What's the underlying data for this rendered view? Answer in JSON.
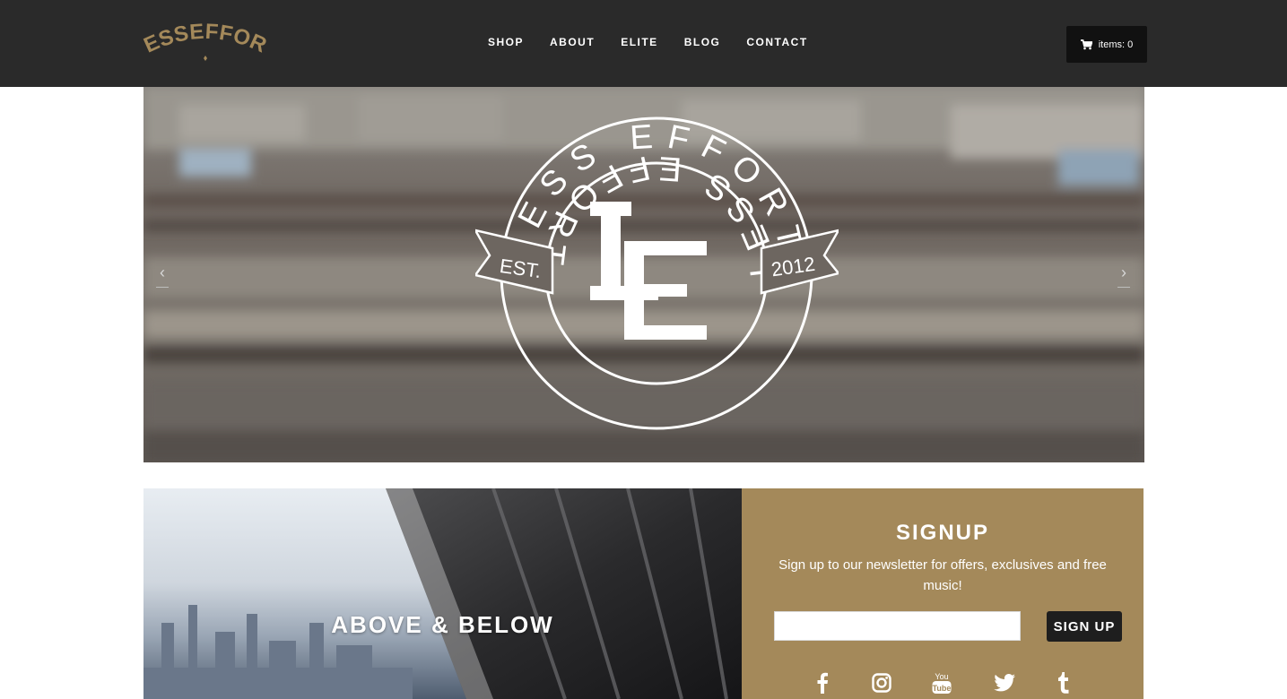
{
  "brand": {
    "logo_text": "LESSEFFORT"
  },
  "nav": {
    "items": [
      {
        "label": "SHOP"
      },
      {
        "label": "ABOUT"
      },
      {
        "label": "ELITE"
      },
      {
        "label": "BLOG"
      },
      {
        "label": "CONTACT"
      }
    ]
  },
  "cart": {
    "label": "items: 0",
    "icon": "cart-icon"
  },
  "hero": {
    "emblem": {
      "top_text": "LESS EFFORT",
      "bottom_text": "LESS EFFORT",
      "left_banner": "EST.",
      "right_banner": "2012",
      "monogram": "LE"
    },
    "prev_icon": "chevron-left-icon",
    "next_icon": "chevron-right-icon"
  },
  "promo": {
    "title": "ABOVE & BELOW"
  },
  "signup": {
    "title": "SIGNUP",
    "text": "Sign up to our newsletter for offers, exclusives and free music!",
    "input_value": "",
    "input_placeholder": "",
    "button_label": "SIGN UP"
  },
  "social": {
    "icons": [
      "facebook-icon",
      "instagram-icon",
      "youtube-icon",
      "twitter-icon",
      "tumblr-icon"
    ]
  },
  "colors": {
    "topbar": "#2a2a2a",
    "brand_gold": "#a4895a",
    "dark_button": "#1e1e1e"
  }
}
